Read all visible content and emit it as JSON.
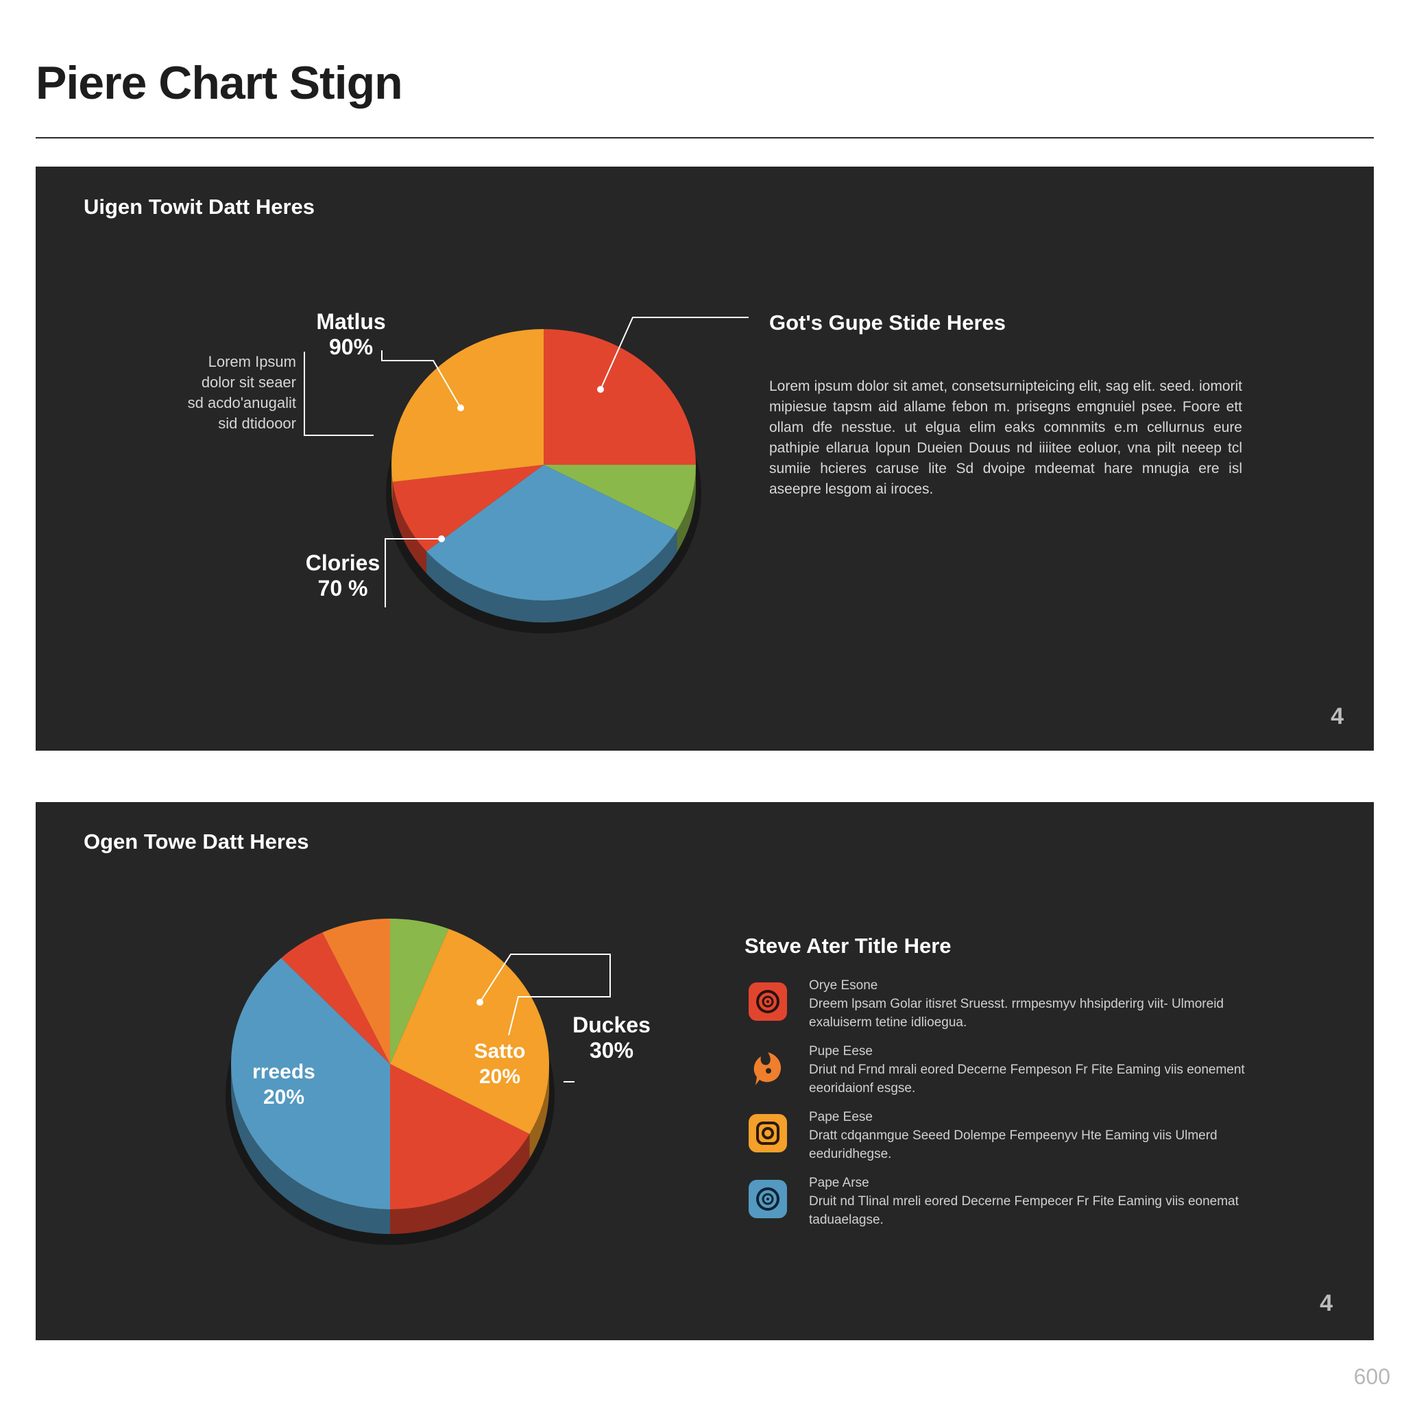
{
  "page": {
    "title": "Piere Chart Stign",
    "corner_number": "600"
  },
  "colors": {
    "orange": "#f4a02a",
    "red": "#e2452e",
    "green": "#8bb84a",
    "blue": "#5499c1",
    "deep_orange": "#ef7f2c",
    "panel_bg": "#262626"
  },
  "panel_top": {
    "heading": "Uigen Towit Datt Heres",
    "slide_number": "4",
    "callout_1": {
      "name": "Matlus",
      "value": "90%"
    },
    "callout_2": {
      "name": "Clories",
      "value": "70 %"
    },
    "note_lines": [
      "Lorem Ipsum",
      "dolor sit seaer",
      "sd acdo'anugalit",
      "sid dtidooor"
    ],
    "desc_heading": "Got's Gupe Stide Heres",
    "desc_body": "Lorem ipsum dolor sit amet, consetsurnipteicing elit, sag elit. seed. iomorit mipiesue tapsm aid allame febon m. prisegns emgnuiel psee. Foore ett ollam dfe nesstue. ut elgua elim eaks comnmits e.m cellurnus eure pathipie ellarua lopun Dueien Douus nd iiiitee eoluor, vna pilt neeep tcl sumiie hcieres caruse lite Sd dvoipe mdeemat hare mnugia ere isl aseepre lesgom ai iroces."
  },
  "panel_bottom": {
    "heading": "Ogen Towe Datt Heres",
    "slide_number": "4",
    "label_preeds": {
      "name": "rreeds",
      "value": "20%"
    },
    "label_satto": {
      "name": "Satto",
      "value": "20%"
    },
    "label_duckes": {
      "name": "Duckes",
      "value": "30%"
    },
    "list_title": "Steve Ater Title Here",
    "items": [
      {
        "label": "Orye Esone",
        "desc": "Dreem lpsam Golar itisret Sruesst. rrmpesmyv hhsipderirg viit- Ulmoreid exaluiserm tetine idlioegua.",
        "icon": "target-icon",
        "color": "#e2452e"
      },
      {
        "label": "Pupe Eese",
        "desc": "Driut nd Frnd mrali eored Decerne Fempeson Fr Fite Eaming viis eonement eeoridaionf esgse.",
        "icon": "flame-chat-icon",
        "color": "#ef7f2c"
      },
      {
        "label": "Pape Eese",
        "desc": "Dratt cdqanmgue Seeed Dolempe Fempeenyv Hte Eaming viis Ulmerd eeduridhegse.",
        "icon": "camera-icon",
        "color": "#f4a02a"
      },
      {
        "label": "Pape Arse",
        "desc": "Druit nd Tlinal mreli eored Decerne Fempecer Fr Fite Eaming viis eonemat taduaelagse.",
        "icon": "target-icon",
        "color": "#5499c1"
      }
    ]
  },
  "chart_data": [
    {
      "type": "pie",
      "title": "Uigen Towit Datt Heres",
      "slices": [
        {
          "label": "",
          "value": 25,
          "color": "#e2452e"
        },
        {
          "label": "",
          "value": 8,
          "color": "#8bb84a"
        },
        {
          "label": "",
          "value": 31,
          "color": "#5499c1"
        },
        {
          "label": "Clories 70 %",
          "value": 9,
          "color": "#e2452e"
        },
        {
          "label": "Matlus 90%",
          "value": 27,
          "color": "#f4a02a"
        }
      ]
    },
    {
      "type": "pie",
      "title": "Ogen Towe Datt Heres",
      "slices": [
        {
          "label": "",
          "value": 6,
          "color": "#8bb84a"
        },
        {
          "label": "Satto 20% / Duckes 30%",
          "value": 27,
          "color": "#f4a02a"
        },
        {
          "label": "",
          "value": 17,
          "color": "#e2452e"
        },
        {
          "label": "rreeds 20%",
          "value": 38,
          "color": "#5499c1"
        },
        {
          "label": "",
          "value": 5,
          "color": "#e2452e"
        },
        {
          "label": "",
          "value": 7,
          "color": "#ef7f2c"
        }
      ]
    }
  ]
}
